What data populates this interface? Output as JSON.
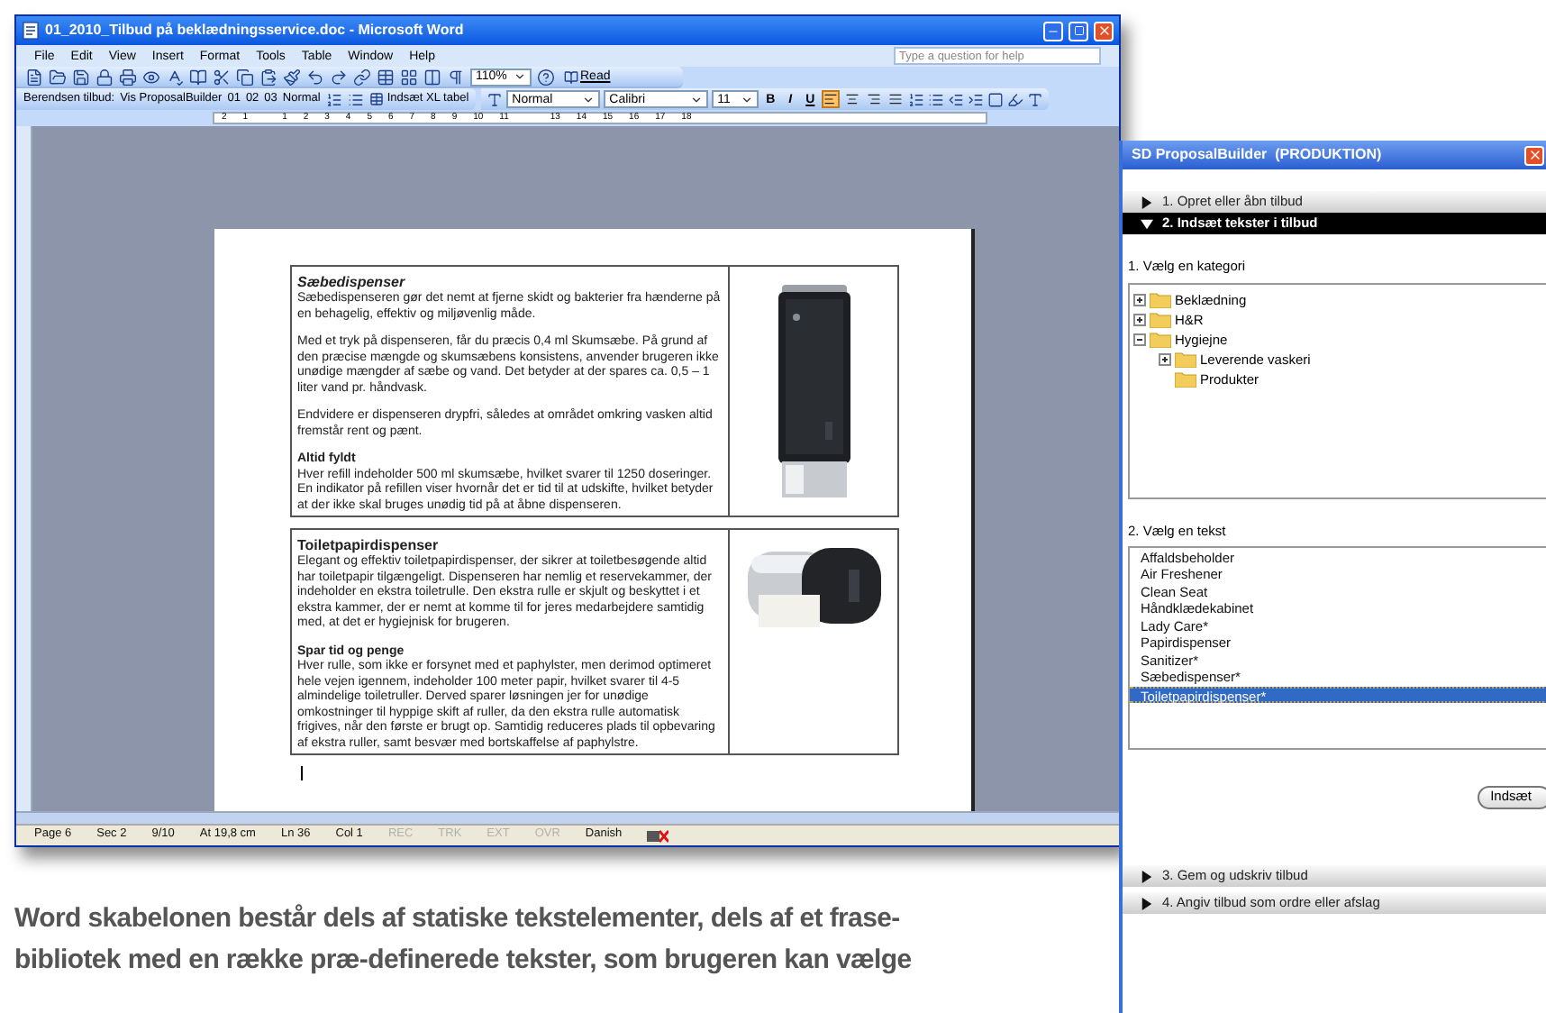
{
  "word_window": {
    "title": "01_2010_Tilbud på beklædningsservice.doc - Microsoft Word",
    "menu": [
      "File",
      "Edit",
      "View",
      "Insert",
      "Format",
      "Tools",
      "Table",
      "Window",
      "Help"
    ],
    "help_search": {
      "placeholder": "Type a question for help"
    },
    "standard_toolbar": {
      "zoom": "110%",
      "read_button": "Read"
    },
    "custom_toolbar": {
      "label": "Berendsen tilbud:",
      "buttons": [
        "Vis ProposalBuilder",
        "01",
        "02",
        "03",
        "Normal"
      ],
      "insert_table_button": "Indsæt XL tabel"
    },
    "formatting_toolbar": {
      "style": "Normal",
      "font": "Calibri",
      "size": "11",
      "format_buttons": [
        "B",
        "I",
        "U"
      ],
      "alignment": [
        {
          "selected": true
        },
        {
          "selected": false
        },
        {
          "selected": false
        },
        {
          "selected": false
        }
      ]
    },
    "ruler_numbers": [
      "2",
      "1",
      "1",
      "2",
      "3",
      "4",
      "5",
      "6",
      "7",
      "8",
      "9",
      "10",
      "11",
      "13",
      "14",
      "15",
      "16",
      "17",
      "18"
    ],
    "document": {
      "sections": [
        {
          "title": "Sæbedispenser",
          "italic": true,
          "blocks": [
            {
              "kind": "paragraph",
              "text": "Sæbedispenseren gør det nemt at fjerne skidt og bakterier fra hænderne på en behagelig, effektiv og miljøvenlig måde."
            },
            {
              "kind": "paragraph",
              "text": "Med et tryk på dispenseren, får du præcis 0,4 ml Skumsæbe. På grund af den præcise mængde og skumsæbens konsistens, anvender brugeren ikke unødige mængder af sæbe og vand. Det betyder at der spares ca. 0,5 – 1 liter vand pr. håndvask."
            },
            {
              "kind": "paragraph",
              "text": "Endvidere er dispenseren drypfri, således at området omkring vasken altid fremstår rent og pænt."
            },
            {
              "kind": "heading",
              "text": "Altid fyldt"
            },
            {
              "kind": "paragraph",
              "text": "Hver refill indeholder 500 ml skumsæbe, hvilket svarer til 1250 doseringer. En indikator på refillen viser hvornår det er tid til at udskifte, hvilket betyder at der ikke skal bruges unødig tid på at åbne dispenseren."
            }
          ],
          "picture": {
            "kind": "soap"
          }
        },
        {
          "title": "Toiletpapirdispenser",
          "italic": false,
          "blocks": [
            {
              "kind": "paragraph",
              "text": "Elegant og effektiv toiletpapirdispenser, der sikrer at toiletbesøgende altid har toiletpapir tilgængeligt. Dispenseren har nemlig et reservekammer, der indeholder en ekstra toiletrulle. Den ekstra rulle er skjult og beskyttet i et ekstra kammer, der er nemt at komme til for jeres medarbejdere samtidig med, at det er hygiejnisk for brugeren."
            },
            {
              "kind": "heading",
              "text": "Spar tid og penge"
            },
            {
              "kind": "paragraph",
              "text": "Hver rulle, som ikke er forsynet med et paphylster, men derimod optimeret hele vejen igennem, indeholder 100 meter papir, hvilket svarer til 4-5 almindelige toiletruller. Derved sparer løsningen jer for unødige omkostninger til hyppige skift af ruller, da den ekstra rulle automatisk frigives, når den første er brugt op. Samtidig reduceres plads til opbevaring af ekstra ruller, samt besvær med bortskaffelse af paphylstre."
            }
          ],
          "picture": {
            "kind": "toilet_paper"
          }
        }
      ]
    },
    "status_bar": [
      {
        "text": "Page 6",
        "disabled": false
      },
      {
        "text": "Sec 2",
        "disabled": false
      },
      {
        "text": "9/10",
        "disabled": false
      },
      {
        "text": "At 19,8 cm",
        "disabled": false
      },
      {
        "text": "Ln 36",
        "disabled": false
      },
      {
        "text": "Col 1",
        "disabled": false
      },
      {
        "text": "REC",
        "disabled": true
      },
      {
        "text": "TRK",
        "disabled": true
      },
      {
        "text": "EXT",
        "disabled": true
      },
      {
        "text": "OVR",
        "disabled": true
      },
      {
        "text": "Danish",
        "disabled": false
      }
    ]
  },
  "panel": {
    "title": "SD ProposalBuilder  (PRODUKTION)",
    "sections": [
      {
        "label": "1. Opret eller åbn tilbud",
        "expanded": false
      },
      {
        "label": "2. Indsæt tekster i tilbud",
        "expanded": true
      },
      {
        "label": "3. Gem og udskriv tilbud",
        "expanded": false
      },
      {
        "label": "4. Angiv tilbud som ordre eller afslag",
        "expanded": false
      }
    ],
    "category_label": "1. Vælg en kategori",
    "tree": [
      {
        "label": "Beklædning",
        "expanded": false
      },
      {
        "label": "H&R",
        "expanded": false
      },
      {
        "label": "Hygiejne",
        "expanded": true,
        "children": [
          {
            "label": "Leverende vaskeri",
            "expanded": false
          },
          {
            "label": "Produkter"
          }
        ]
      }
    ],
    "text_label": "2. Vælg en tekst",
    "texts": [
      {
        "label": "Affaldsbeholder",
        "selected": false
      },
      {
        "label": "Air Freshener",
        "selected": false
      },
      {
        "label": "Clean Seat",
        "selected": false
      },
      {
        "label": "Håndklædekabinet",
        "selected": false
      },
      {
        "label": "Lady Care*",
        "selected": false
      },
      {
        "label": "Papirdispenser",
        "selected": false
      },
      {
        "label": "Sanitizer*",
        "selected": false
      },
      {
        "label": "Sæbedispenser*",
        "selected": false
      },
      {
        "label": "Toiletpapirdispenser*",
        "selected": true
      }
    ],
    "insert_button": "Indsæt"
  },
  "caption": {
    "lines": [
      "Word skabelonen består dels af statiske tekstelementer, dels af et frase-",
      "bibliotek med en række præ-definerede tekster, som brugeren kan vælge"
    ]
  }
}
